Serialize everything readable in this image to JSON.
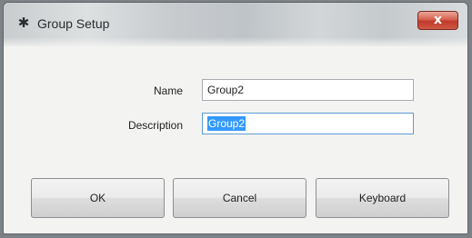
{
  "window": {
    "title": "Group Setup",
    "icon": "gear-icon",
    "close_label": "x"
  },
  "form": {
    "name_label": "Name",
    "name_value": "Group2",
    "description_label": "Description",
    "description_value": "Group2"
  },
  "buttons": {
    "ok": "OK",
    "cancel": "Cancel",
    "keyboard": "Keyboard"
  },
  "colors": {
    "selection": "#3399ff",
    "close_button": "#c0392b"
  }
}
